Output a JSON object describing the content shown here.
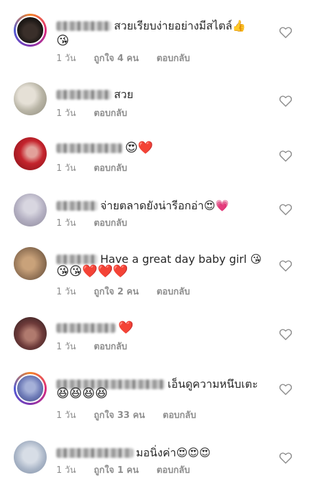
{
  "comments": [
    {
      "text": "สวยเรียบง่ายอย่างมีสไตล์👍",
      "second_line": "😘",
      "time": "1 วัน",
      "likes": "ถูกใจ 4 คน",
      "reply": "ตอบกลับ"
    },
    {
      "text": "สวย",
      "second_line": "",
      "time": "1 วัน",
      "likes": "",
      "reply": "ตอบกลับ"
    },
    {
      "text": "😍❤️",
      "second_line": "",
      "time": "1 วัน",
      "likes": "",
      "reply": "ตอบกลับ"
    },
    {
      "text": "จ่ายตลาดยังน่ารีอกอ่า😍💗",
      "second_line": "",
      "time": "1 วัน",
      "likes": "",
      "reply": "ตอบกลับ"
    },
    {
      "text": "Have a great day baby girl 😘",
      "second_line": "😘😘❤️❤️❤️",
      "time": "1 วัน",
      "likes": "ถูกใจ 2 คน",
      "reply": "ตอบกลับ"
    },
    {
      "text": "❤️",
      "second_line": "",
      "time": "1 วัน",
      "likes": "",
      "reply": "ตอบกลับ"
    },
    {
      "text": "เอ็นดูความหนึบเตะ",
      "second_line": "😆😆😆😆",
      "time": "1 วัน",
      "likes": "ถูกใจ 33 คน",
      "reply": "ตอบกลับ"
    },
    {
      "text": "มอนิ่งค่า😍😍😍",
      "second_line": "",
      "time": "1 วัน",
      "likes": "ถูกใจ 1 คน",
      "reply": "ตอบกลับ"
    }
  ],
  "icons": {
    "like": "heart-outline-icon"
  },
  "colors": {
    "text": "#262626",
    "meta": "#8e8e8e",
    "heart_emoji": "#e0162b"
  }
}
